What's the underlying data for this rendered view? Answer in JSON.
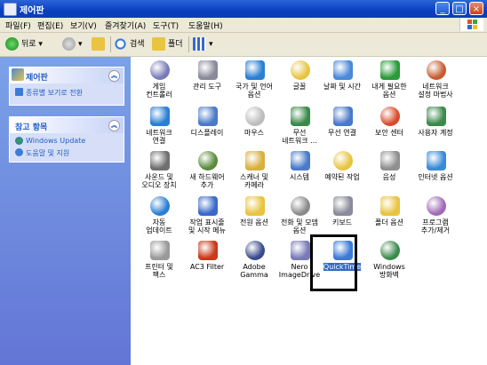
{
  "window": {
    "title": "제어판"
  },
  "menu": [
    "파일(F)",
    "편집(E)",
    "보기(V)",
    "즐겨찾기(A)",
    "도구(T)",
    "도움말(H)"
  ],
  "toolbar": {
    "back": "뒤로",
    "search": "검색",
    "folders": "폴더"
  },
  "sidebar": {
    "control_panel": {
      "title": "제어판",
      "link": "종류별 보기로 전환"
    },
    "see_also": {
      "title": "참고 항목",
      "links": [
        "Windows Update",
        "도움말 및 지원"
      ]
    }
  },
  "items": [
    {
      "label": "게임\n컨트롤러",
      "icon": "game-controller-icon",
      "color": "#7a7ab8"
    },
    {
      "label": "관리 도구",
      "icon": "admin-tools-icon",
      "color": "#8a8a9a"
    },
    {
      "label": "국가 및 언어\n옵션",
      "icon": "globe-icon",
      "color": "#2a7fd4"
    },
    {
      "label": "글꼴",
      "icon": "fonts-folder-icon",
      "color": "#e8c440"
    },
    {
      "label": "날짜 및 시간",
      "icon": "clock-icon",
      "color": "#4a8ad8"
    },
    {
      "label": "내게 필요한\n옵션",
      "icon": "accessibility-icon",
      "color": "#2a9a3a"
    },
    {
      "label": "네트워크\n설정 마법사",
      "icon": "network-setup-icon",
      "color": "#c85a30"
    },
    {
      "label": "네트워크\n연결",
      "icon": "network-connections-icon",
      "color": "#2a7fd4"
    },
    {
      "label": "디스플레이",
      "icon": "display-icon",
      "color": "#4a7ac8"
    },
    {
      "label": "마우스",
      "icon": "mouse-icon",
      "color": "#bcbcbc"
    },
    {
      "label": "무선\n네트워크 ...",
      "icon": "wireless-network-icon",
      "color": "#3a8a4a"
    },
    {
      "label": "무선 연결",
      "icon": "wireless-link-icon",
      "color": "#4a7ac8"
    },
    {
      "label": "보안 센터",
      "icon": "security-center-icon",
      "color": "#d84a2a"
    },
    {
      "label": "사용자 계정",
      "icon": "user-accounts-icon",
      "color": "#3a8a4a"
    },
    {
      "label": "사운드 및\n오디오 장치",
      "icon": "sound-icon",
      "color": "#707070"
    },
    {
      "label": "새 하드웨어\n추가",
      "icon": "add-hardware-icon",
      "color": "#5a8a3a"
    },
    {
      "label": "스캐너 및\n카메라",
      "icon": "scanner-camera-icon",
      "color": "#d8b040"
    },
    {
      "label": "시스템",
      "icon": "system-icon",
      "color": "#4a7ac8"
    },
    {
      "label": "예약된 작업",
      "icon": "scheduled-tasks-icon",
      "color": "#e8c440"
    },
    {
      "label": "음성",
      "icon": "speech-icon",
      "color": "#909090"
    },
    {
      "label": "인터넷 옵션",
      "icon": "internet-options-icon",
      "color": "#3a8ad8"
    },
    {
      "label": "자동\n업데이트",
      "icon": "automatic-updates-icon",
      "color": "#2a7fd4"
    },
    {
      "label": "작업 표시줄\n및 시작 메뉴",
      "icon": "taskbar-icon",
      "color": "#3a6ac8"
    },
    {
      "label": "전원 옵션",
      "icon": "power-options-icon",
      "color": "#e8c440"
    },
    {
      "label": "전화 및 모뎀\n옵션",
      "icon": "phone-modem-icon",
      "color": "#8a8a8a"
    },
    {
      "label": "키보드",
      "icon": "keyboard-icon",
      "color": "#8a8a9a"
    },
    {
      "label": "폴더 옵션",
      "icon": "folder-options-icon",
      "color": "#e8c440"
    },
    {
      "label": "프로그램\n추가/제거",
      "icon": "add-remove-programs-icon",
      "color": "#a06ab8"
    },
    {
      "label": "프린터 및\n팩스",
      "icon": "printers-faxes-icon",
      "color": "#9a9a9a"
    },
    {
      "label": "AC3 Filter",
      "icon": "ac3-filter-icon",
      "color": "#c83a1a"
    },
    {
      "label": "Adobe\nGamma",
      "icon": "adobe-gamma-icon",
      "color": "#3a4a8a"
    },
    {
      "label": "Nero\nImageDrive",
      "icon": "nero-imagedrive-icon",
      "color": "#7a7ab8"
    },
    {
      "label": "QuickTime",
      "icon": "quicktime-icon",
      "color": "#3a7ad8",
      "selected": true
    },
    {
      "label": "Windows\n방화벽",
      "icon": "windows-firewall-icon",
      "color": "#3a8a4a"
    }
  ]
}
